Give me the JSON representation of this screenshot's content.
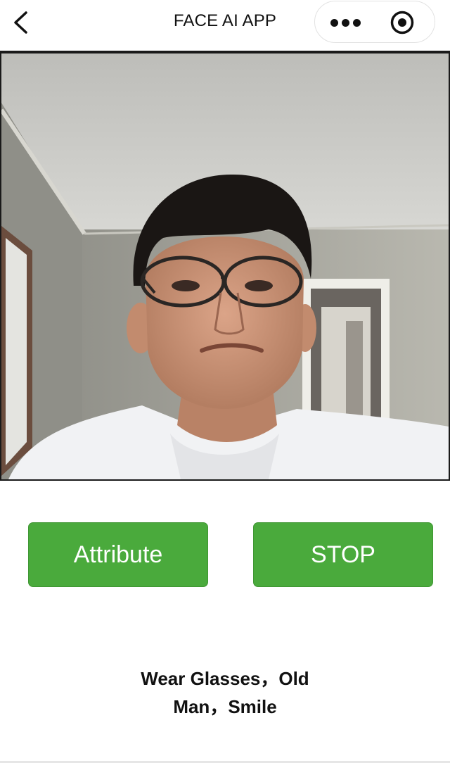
{
  "nav": {
    "title": "FACE AI APP",
    "back_icon": "chevron-left-icon",
    "more_icon": "more-dots-icon",
    "target_icon": "record-target-icon"
  },
  "camera": {
    "content": "live camera feed"
  },
  "buttons": {
    "attribute_label": "Attribute",
    "stop_label": "STOP",
    "color": "#4aaa3c"
  },
  "result": {
    "line1": "Wear Glasses，Old",
    "line2": "Man，Smile"
  }
}
